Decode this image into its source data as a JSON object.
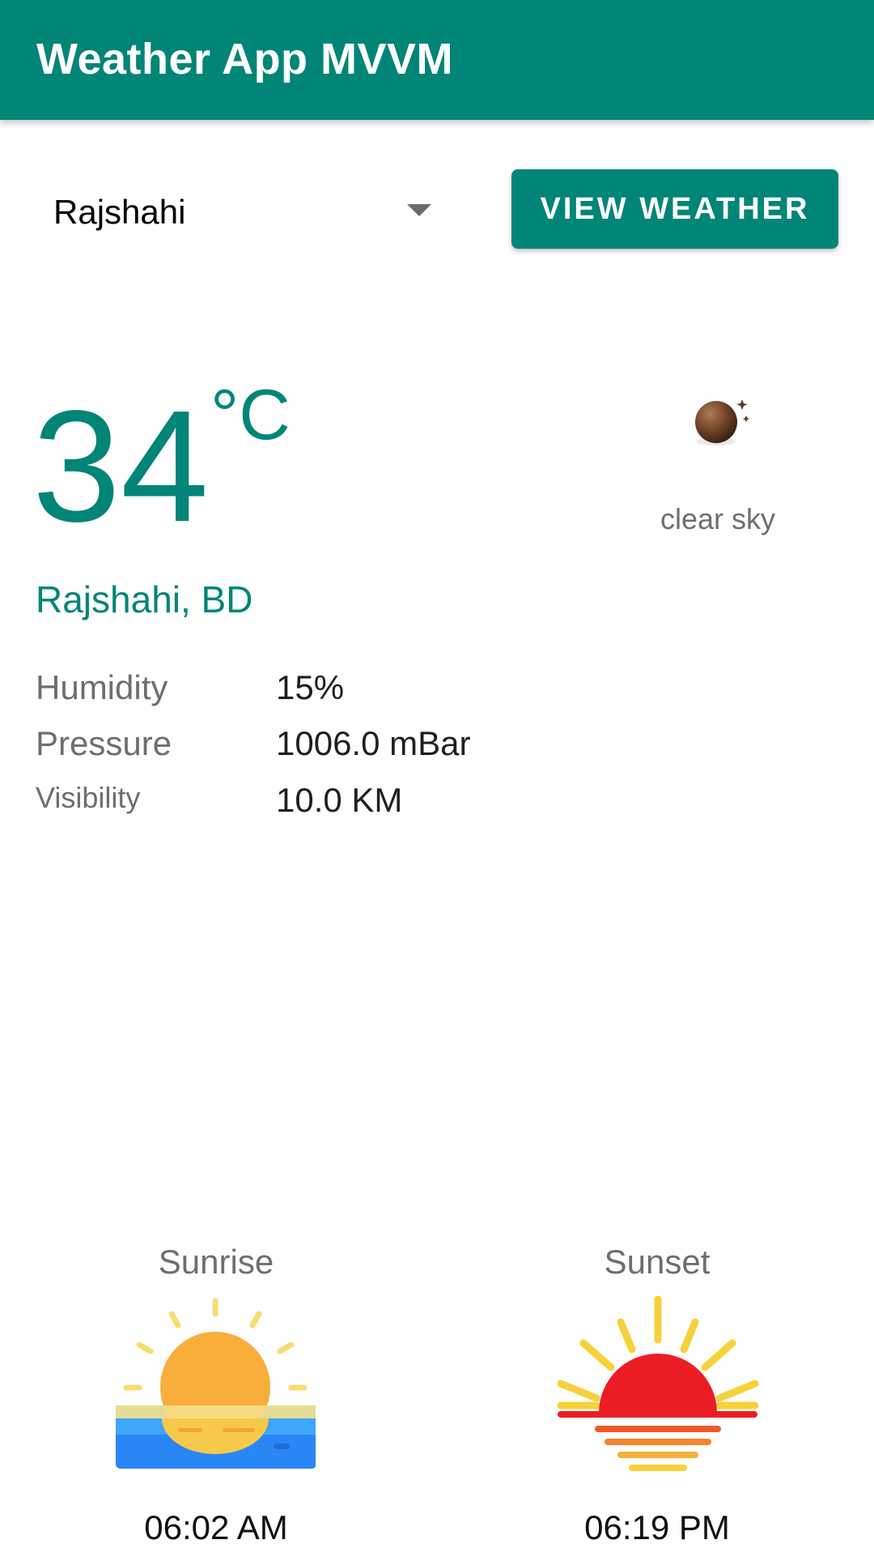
{
  "app_bar": {
    "title": "Weather App MVVM"
  },
  "city_selector": {
    "selected": "Rajshahi"
  },
  "actions": {
    "view_weather_label": "VIEW WEATHER"
  },
  "current": {
    "temperature": "34",
    "unit": "°C",
    "condition": "clear sky",
    "condition_icon": "night-clear-icon",
    "location": "Rajshahi, BD"
  },
  "details": {
    "humidity_label": "Humidity",
    "humidity_value": "15%",
    "pressure_label": "Pressure",
    "pressure_value": "1006.0 mBar",
    "visibility_label": "Visibility",
    "visibility_value": "10.0 KM"
  },
  "sun": {
    "sunrise_label": "Sunrise",
    "sunrise_time": "06:02 AM",
    "sunrise_icon": "sunrise-icon",
    "sunset_label": "Sunset",
    "sunset_time": "06:19 PM",
    "sunset_icon": "sunset-icon"
  },
  "colors": {
    "primary": "#018577",
    "secondary_text": "#6e6e6e",
    "primary_text": "#1f1f1f"
  }
}
